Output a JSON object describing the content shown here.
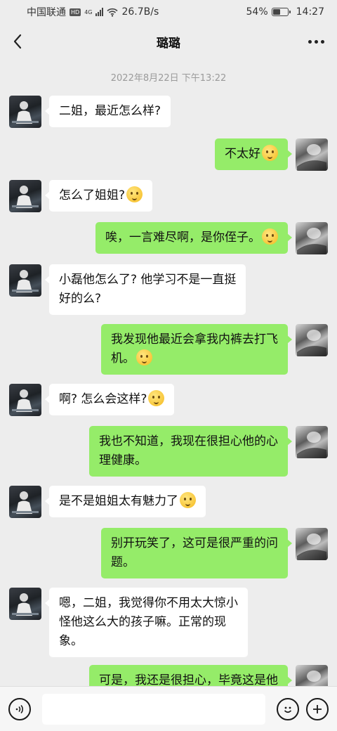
{
  "status_bar": {
    "carrier": "中国联通",
    "hd": "HD",
    "network": "4G",
    "speed": "26.7B/s",
    "battery_percent": "54%",
    "battery_level": 0.54,
    "time": "14:27"
  },
  "nav": {
    "title": "璐璐",
    "back_icon": "chevron-left-icon",
    "more_icon": "more-dots-icon"
  },
  "chat": {
    "timestamp": "2022年8月22日 下午13:22",
    "messages": [
      {
        "side": "left",
        "text": "二姐，最近怎么样?",
        "emoji": false
      },
      {
        "side": "right",
        "text": "不太好",
        "emoji": true
      },
      {
        "side": "left",
        "text": "怎么了姐姐?",
        "emoji": true
      },
      {
        "side": "right",
        "text": "唉，一言难尽啊，是你侄子。",
        "emoji": true
      },
      {
        "side": "left",
        "text": "小磊他怎么了? 他学习不是一直挺\n好的么?",
        "emoji": false
      },
      {
        "side": "right",
        "text": "我发现他最近会拿我内裤去打飞\n机。",
        "emoji": true
      },
      {
        "side": "left",
        "text": "啊? 怎么会这样?",
        "emoji": true
      },
      {
        "side": "right",
        "text": "我也不知道，我现在很担心他的心\n理健康。",
        "emoji": false
      },
      {
        "side": "left",
        "text": "是不是姐姐太有魅力了",
        "emoji": true
      },
      {
        "side": "right",
        "text": "别开玩笑了，这可是很严重的问\n题。",
        "emoji": false
      },
      {
        "side": "left",
        "text": "嗯，二姐，我觉得你不用太大惊小\n怪他这么大的孩子嘛。正常的现\n象。",
        "emoji": false
      },
      {
        "side": "right",
        "text": "可是，我还是很担心，毕竟这是他",
        "emoji": false
      }
    ]
  },
  "input_bar": {
    "voice_icon": "voice-icon",
    "emoji_icon": "emoji-icon",
    "plus_icon": "plus-icon",
    "input_value": ""
  }
}
